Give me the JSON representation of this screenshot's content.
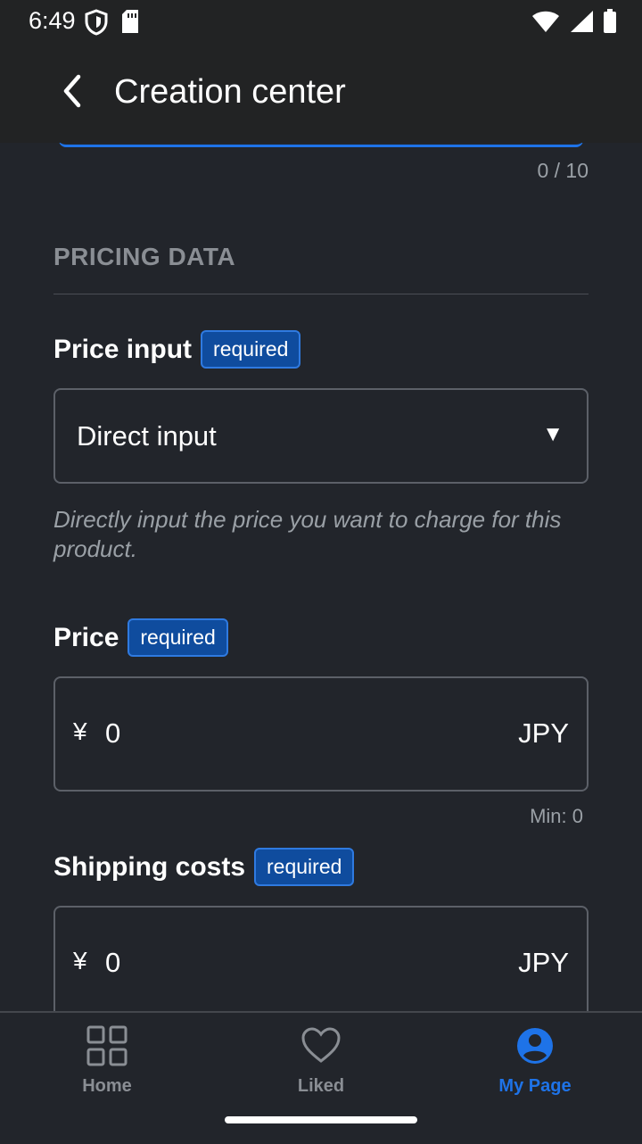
{
  "status_bar": {
    "time": "6:49"
  },
  "app_bar": {
    "title": "Creation center"
  },
  "form": {
    "prev_counter": "0 / 10",
    "section_title": "PRICING DATA",
    "price_input": {
      "label": "Price input",
      "badge": "required",
      "selected": "Direct input",
      "helper": "Directly input the price you want to charge for this product."
    },
    "price": {
      "label": "Price",
      "badge": "required",
      "prefix": "¥",
      "value": "0",
      "suffix": "JPY",
      "hint": "Min: 0"
    },
    "shipping": {
      "label": "Shipping costs",
      "badge": "required",
      "prefix": "¥",
      "value": "0",
      "suffix": "JPY"
    }
  },
  "bottom_nav": {
    "items": [
      {
        "label": "Home",
        "icon": "grid-icon",
        "active": false
      },
      {
        "label": "Liked",
        "icon": "heart-icon",
        "active": false
      },
      {
        "label": "My Page",
        "icon": "user-icon",
        "active": true
      }
    ]
  },
  "colors": {
    "accent": "#1e73e8",
    "background": "#22252b",
    "badge_bg": "#0f4c9e"
  }
}
